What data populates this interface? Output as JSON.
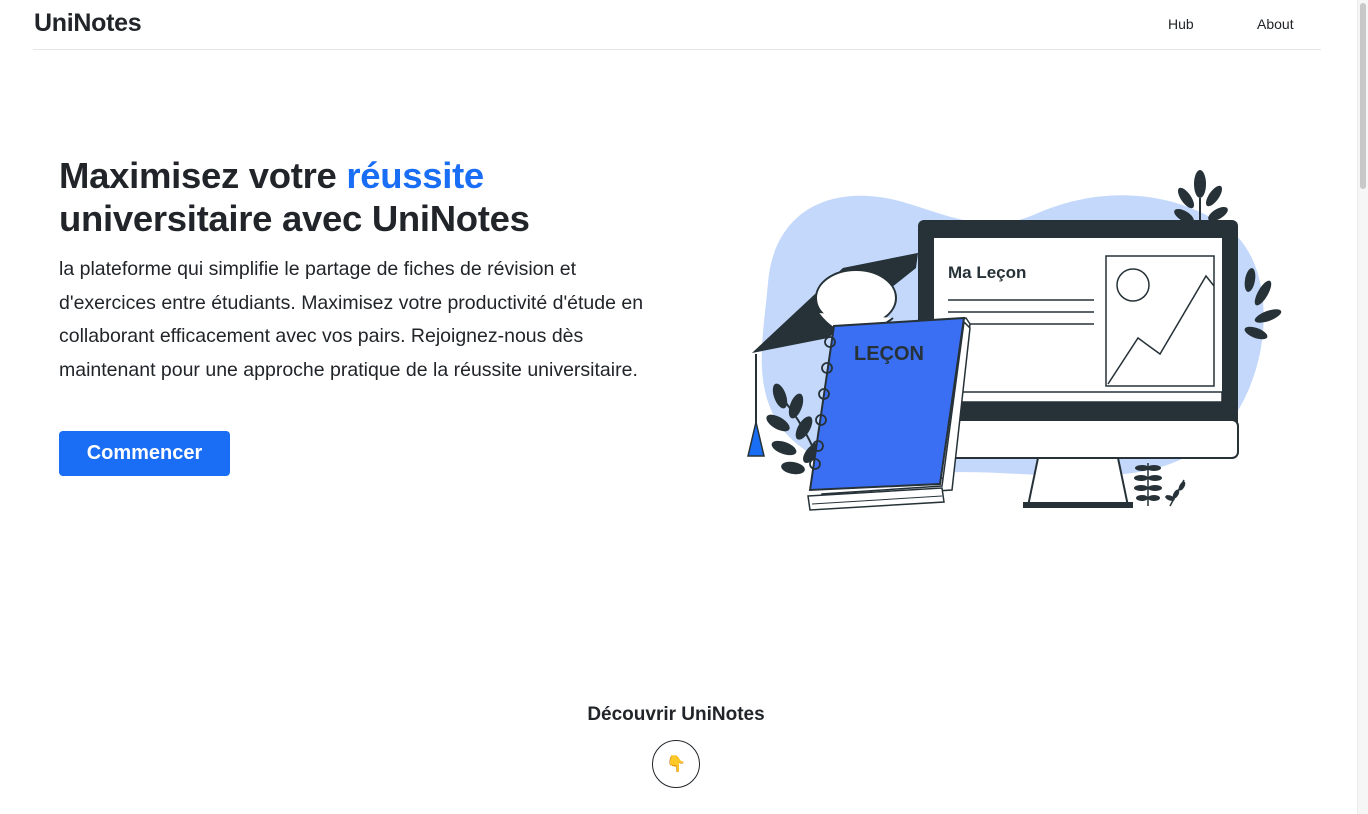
{
  "navbar": {
    "brand": "UniNotes",
    "links": [
      {
        "label": "Hub"
      },
      {
        "label": "About"
      }
    ]
  },
  "hero": {
    "title_part1": "Maximisez votre ",
    "title_accent": "réussite",
    "title_part2": " universitaire avec UniNotes",
    "description": "la plateforme qui simplifie le partage de fiches de révision et d'exercices entre étudiants. Maximisez votre productivité d'étude en collaborant efficacement avec vos pairs. Rejoignez-nous dès maintenant pour une approche pratique de la réussite universitaire.",
    "cta_label": "Commencer"
  },
  "illustration": {
    "screen_title": "Ma Leçon",
    "book_label": "LEÇON",
    "icons": [
      "graduation-cap-icon",
      "monitor-icon",
      "notebook-icon",
      "plant-icon"
    ]
  },
  "discover": {
    "label": "Découvrir UniNotes",
    "button_icon": "👇",
    "icon_name": "pointing-down-icon"
  },
  "colors": {
    "accent": "#1a6ef5",
    "text": "#212529",
    "blob": "#c3d8fb",
    "dark": "#263238"
  }
}
